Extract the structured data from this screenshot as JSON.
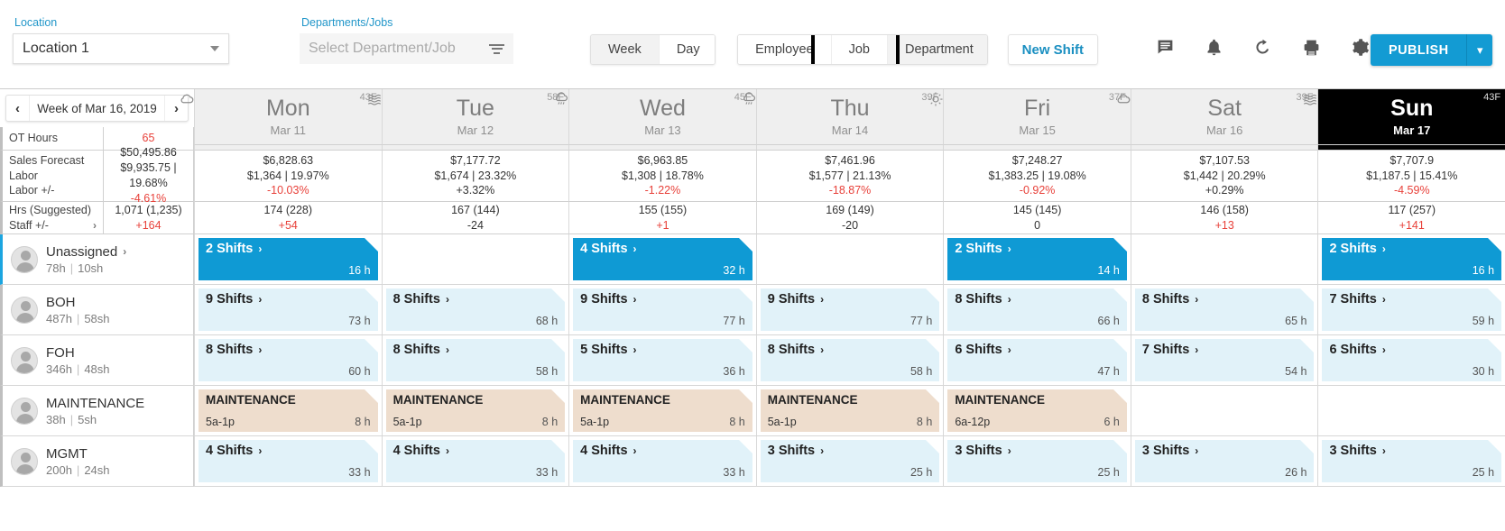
{
  "toolbar": {
    "location_label": "Location",
    "location_value": "Location 1",
    "dept_label": "Departments/Jobs",
    "dept_placeholder": "Select Department/Job",
    "view_modes": [
      {
        "label": "Week",
        "active": true
      },
      {
        "label": "Day",
        "active": false
      }
    ],
    "group_by": [
      {
        "label": "Employee",
        "active": false
      },
      {
        "label": "Job",
        "active": false
      },
      {
        "label": "Department",
        "active": true,
        "selected_outline": true
      }
    ],
    "new_shift_label": "New Shift",
    "icons": [
      "message-icon",
      "bell-icon",
      "refresh-icon",
      "print-icon",
      "gear-icon"
    ],
    "publish_label": "PUBLISH",
    "publish_caret": "⌄",
    "accent_color": "#139bd3",
    "link_color": "#1a8fc1"
  },
  "week_nav": {
    "prev": "‹",
    "label": "Week of Mar 16, 2019",
    "next": "›"
  },
  "days": [
    {
      "name": "Mon",
      "date": "Mar 11",
      "temp": "43F",
      "weather": "cloud-icon",
      "today": false
    },
    {
      "name": "Tue",
      "date": "Mar 12",
      "temp": "58F",
      "weather": "fog-icon",
      "today": false
    },
    {
      "name": "Wed",
      "date": "Mar 13",
      "temp": "45F",
      "weather": "rain-icon",
      "today": false
    },
    {
      "name": "Thu",
      "date": "Mar 14",
      "temp": "39F",
      "weather": "rain-icon",
      "today": false
    },
    {
      "name": "Fri",
      "date": "Mar 15",
      "temp": "37F",
      "weather": "sun-icon",
      "today": false
    },
    {
      "name": "Sat",
      "date": "Mar 16",
      "temp": "39F",
      "weather": "cloud-icon",
      "today": false
    },
    {
      "name": "Sun",
      "date": "Mar 17",
      "temp": "43F",
      "weather": "fog-icon",
      "today": true
    }
  ],
  "metrics": {
    "ot": {
      "label": "OT Hours",
      "total": "65",
      "total_color": "#e8413a"
    },
    "sales": {
      "labels": [
        "Sales Forecast",
        "Labor",
        "Labor +/-"
      ],
      "total": {
        "forecast": "$50,495.86",
        "labor": "$9,935.75 | 19.68%",
        "delta": "-4.61%",
        "delta_neg": true
      },
      "days": [
        {
          "forecast": "$6,828.63",
          "labor": "$1,364 | 19.97%",
          "delta": "-10.03%",
          "delta_neg": true
        },
        {
          "forecast": "$7,177.72",
          "labor": "$1,674 | 23.32%",
          "delta": "+3.32%",
          "delta_neg": false
        },
        {
          "forecast": "$6,963.85",
          "labor": "$1,308 | 18.78%",
          "delta": "-1.22%",
          "delta_neg": true
        },
        {
          "forecast": "$7,461.96",
          "labor": "$1,577 | 21.13%",
          "delta": "-18.87%",
          "delta_neg": true
        },
        {
          "forecast": "$7,248.27",
          "labor": "$1,383.25 | 19.08%",
          "delta": "-0.92%",
          "delta_neg": true
        },
        {
          "forecast": "$7,107.53",
          "labor": "$1,442 | 20.29%",
          "delta": "+0.29%",
          "delta_neg": false
        },
        {
          "forecast": "$7,707.9",
          "labor": "$1,187.5 | 15.41%",
          "delta": "-4.59%",
          "delta_neg": true
        }
      ]
    },
    "hours": {
      "labels": [
        "Hrs (Suggested)",
        "Staff +/-"
      ],
      "total": {
        "hrs": "1,071 (1,235)",
        "staff": "+164",
        "staff_neg": true
      },
      "days": [
        {
          "hrs": "174 (228)",
          "staff": "+54",
          "staff_neg": true
        },
        {
          "hrs": "167 (144)",
          "staff": "-24",
          "staff_neg": false
        },
        {
          "hrs": "155 (155)",
          "staff": "+1",
          "staff_neg": true
        },
        {
          "hrs": "169 (149)",
          "staff": "-20",
          "staff_neg": false
        },
        {
          "hrs": "145 (145)",
          "staff": "0",
          "staff_neg": false
        },
        {
          "hrs": "146 (158)",
          "staff": "+13",
          "staff_neg": true
        },
        {
          "hrs": "117 (257)",
          "staff": "+141",
          "staff_neg": true
        }
      ]
    }
  },
  "rows": [
    {
      "name": "Unassigned",
      "hours": "78h",
      "shifts": "10sh",
      "has_chevron": true,
      "accent": true,
      "cells": [
        {
          "type": "blue",
          "title": "2 Shifts",
          "hours": "16 h"
        },
        {
          "type": "empty"
        },
        {
          "type": "blue",
          "title": "4 Shifts",
          "hours": "32 h"
        },
        {
          "type": "empty"
        },
        {
          "type": "blue",
          "title": "2 Shifts",
          "hours": "14 h"
        },
        {
          "type": "empty"
        },
        {
          "type": "blue",
          "title": "2 Shifts",
          "hours": "16 h"
        }
      ]
    },
    {
      "name": "BOH",
      "hours": "487h",
      "shifts": "58sh",
      "has_chevron": false,
      "accent": false,
      "cells": [
        {
          "type": "light",
          "title": "9 Shifts",
          "hours": "73 h"
        },
        {
          "type": "light",
          "title": "8 Shifts",
          "hours": "68 h"
        },
        {
          "type": "light",
          "title": "9 Shifts",
          "hours": "77 h"
        },
        {
          "type": "light",
          "title": "9 Shifts",
          "hours": "77 h"
        },
        {
          "type": "light",
          "title": "8 Shifts",
          "hours": "66 h"
        },
        {
          "type": "light",
          "title": "8 Shifts",
          "hours": "65 h"
        },
        {
          "type": "light",
          "title": "7 Shifts",
          "hours": "59 h"
        }
      ]
    },
    {
      "name": "FOH",
      "hours": "346h",
      "shifts": "48sh",
      "has_chevron": false,
      "accent": false,
      "cells": [
        {
          "type": "light",
          "title": "8 Shifts",
          "hours": "60 h"
        },
        {
          "type": "light",
          "title": "8 Shifts",
          "hours": "58 h"
        },
        {
          "type": "light",
          "title": "5 Shifts",
          "hours": "36 h"
        },
        {
          "type": "light",
          "title": "8 Shifts",
          "hours": "58 h"
        },
        {
          "type": "light",
          "title": "6 Shifts",
          "hours": "47 h"
        },
        {
          "type": "light",
          "title": "7 Shifts",
          "hours": "54 h"
        },
        {
          "type": "light",
          "title": "6 Shifts",
          "hours": "30 h"
        }
      ]
    },
    {
      "name": "MAINTENANCE",
      "hours": "38h",
      "shifts": "5sh",
      "has_chevron": false,
      "accent": false,
      "cells": [
        {
          "type": "tan",
          "title": "MAINTENANCE",
          "sub": "5a-1p",
          "hours": "8 h"
        },
        {
          "type": "tan",
          "title": "MAINTENANCE",
          "sub": "5a-1p",
          "hours": "8 h"
        },
        {
          "type": "tan",
          "title": "MAINTENANCE",
          "sub": "5a-1p",
          "hours": "8 h"
        },
        {
          "type": "tan",
          "title": "MAINTENANCE",
          "sub": "5a-1p",
          "hours": "8 h"
        },
        {
          "type": "tan",
          "title": "MAINTENANCE",
          "sub": "6a-12p",
          "hours": "6 h"
        },
        {
          "type": "empty"
        },
        {
          "type": "empty"
        }
      ]
    },
    {
      "name": "MGMT",
      "hours": "200h",
      "shifts": "24sh",
      "has_chevron": false,
      "accent": false,
      "cells": [
        {
          "type": "light",
          "title": "4 Shifts",
          "hours": "33 h"
        },
        {
          "type": "light",
          "title": "4 Shifts",
          "hours": "33 h"
        },
        {
          "type": "light",
          "title": "4 Shifts",
          "hours": "33 h"
        },
        {
          "type": "light",
          "title": "3 Shifts",
          "hours": "25 h"
        },
        {
          "type": "light",
          "title": "3 Shifts",
          "hours": "25 h"
        },
        {
          "type": "light",
          "title": "3 Shifts",
          "hours": "26 h"
        },
        {
          "type": "light",
          "title": "3 Shifts",
          "hours": "25 h"
        }
      ]
    }
  ]
}
